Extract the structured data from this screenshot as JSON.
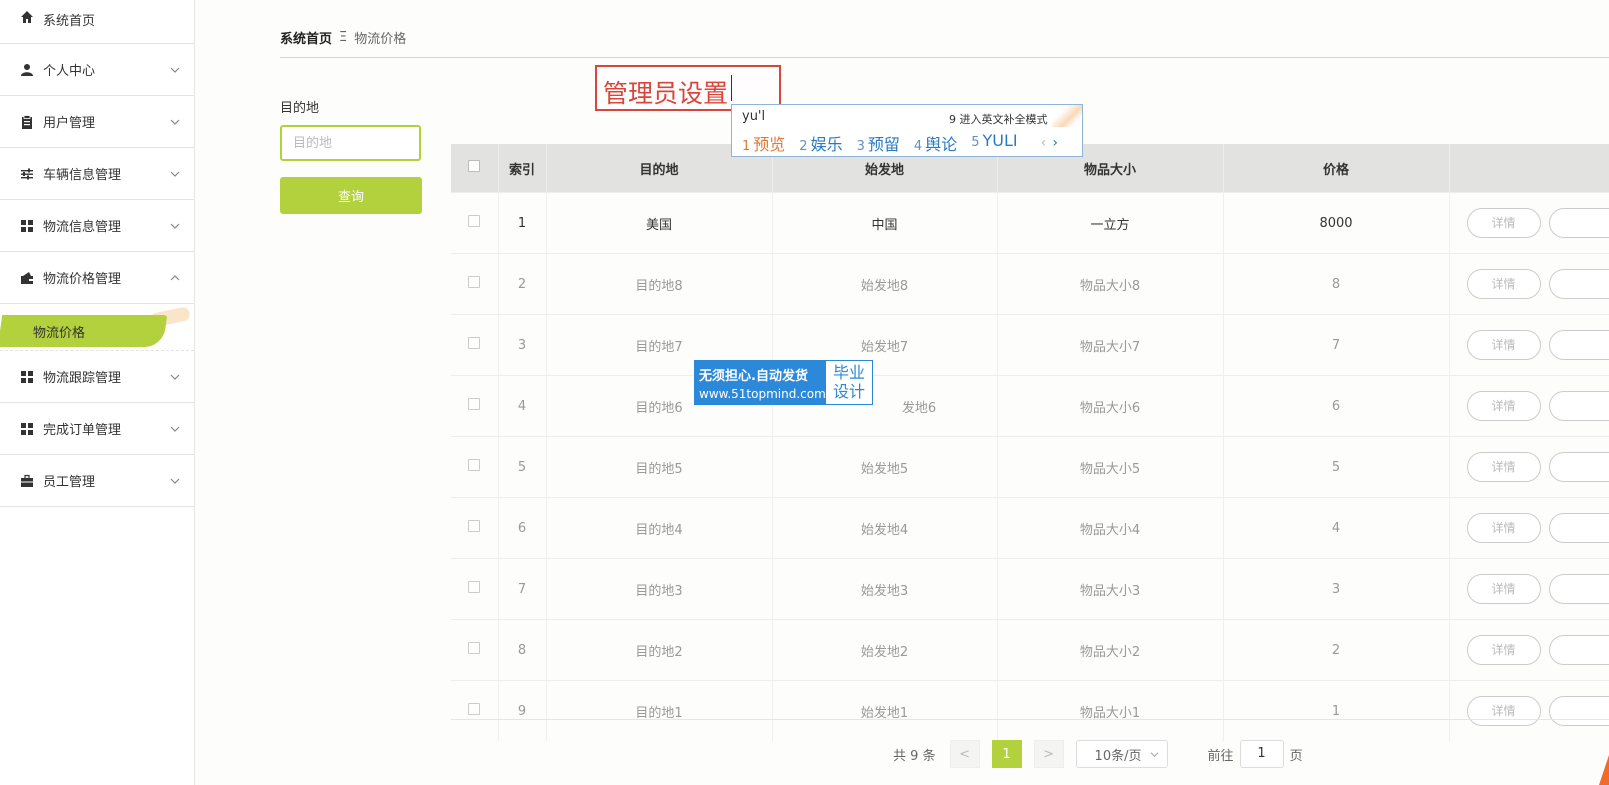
{
  "sidebar": {
    "items": [
      {
        "label": "系统首页",
        "icon": "home-icon"
      },
      {
        "label": "个人中心",
        "icon": "user-icon"
      },
      {
        "label": "用户管理",
        "icon": "clipboard-icon"
      },
      {
        "label": "车辆信息管理",
        "icon": "sliders-icon"
      },
      {
        "label": "物流信息管理",
        "icon": "grid-icon"
      },
      {
        "label": "物流价格管理",
        "icon": "wallet-icon"
      },
      {
        "label": "物流跟踪管理",
        "icon": "grid-icon"
      },
      {
        "label": "完成订单管理",
        "icon": "grid-icon"
      },
      {
        "label": "员工管理",
        "icon": "briefcase-icon"
      }
    ],
    "active_sub": "物流价格"
  },
  "breadcrumb": {
    "home": "系统首页",
    "separator": "Ξ",
    "current": "物流价格"
  },
  "search": {
    "label": "目的地",
    "placeholder": "目的地",
    "button": "查询"
  },
  "table": {
    "headers": [
      "索引",
      "目的地",
      "始发地",
      "物品大小",
      "价格"
    ],
    "detail_label": "详情",
    "rows": [
      {
        "index": "1",
        "dest": "美国",
        "origin": "中国",
        "size": "一立方",
        "price": "8000"
      },
      {
        "index": "2",
        "dest": "目的地8",
        "origin": "始发地8",
        "size": "物品大小8",
        "price": "8"
      },
      {
        "index": "3",
        "dest": "目的地7",
        "origin": "始发地7",
        "size": "物品大小7",
        "price": "7"
      },
      {
        "index": "4",
        "dest": "目的地6",
        "origin": "发地6",
        "size": "物品大小6",
        "price": "6"
      },
      {
        "index": "5",
        "dest": "目的地5",
        "origin": "始发地5",
        "size": "物品大小5",
        "price": "5"
      },
      {
        "index": "6",
        "dest": "目的地4",
        "origin": "始发地4",
        "size": "物品大小4",
        "price": "4"
      },
      {
        "index": "7",
        "dest": "目的地3",
        "origin": "始发地3",
        "size": "物品大小3",
        "price": "3"
      },
      {
        "index": "8",
        "dest": "目的地2",
        "origin": "始发地2",
        "size": "物品大小2",
        "price": "2"
      },
      {
        "index": "9",
        "dest": "目的地1",
        "origin": "始发地1",
        "size": "物品大小1",
        "price": "1"
      }
    ]
  },
  "pagination": {
    "total": "共 9 条",
    "prev": "<",
    "current": "1",
    "next": ">",
    "page_size": "10条/页",
    "goto_label": "前往",
    "goto_value": "1",
    "page_unit": "页"
  },
  "title_input": {
    "value": "管理员设置"
  },
  "ime": {
    "input": "yu'l",
    "hint": "9 进入英文补全模式",
    "candidates": [
      {
        "n": "1",
        "w": "预览"
      },
      {
        "n": "2",
        "w": "娱乐"
      },
      {
        "n": "3",
        "w": "预留"
      },
      {
        "n": "4",
        "w": "舆论"
      },
      {
        "n": "5",
        "w": "YULI"
      }
    ],
    "prev": "‹",
    "next": "›"
  },
  "watermark": {
    "line1": "无须担心.自动发货",
    "line2": "www.51topmind.com",
    "right1": "毕业",
    "right2": "设计"
  },
  "colors": {
    "accent": "#b3d13c",
    "title_red": "#d8463b",
    "watermark_blue": "#2c88d8"
  }
}
